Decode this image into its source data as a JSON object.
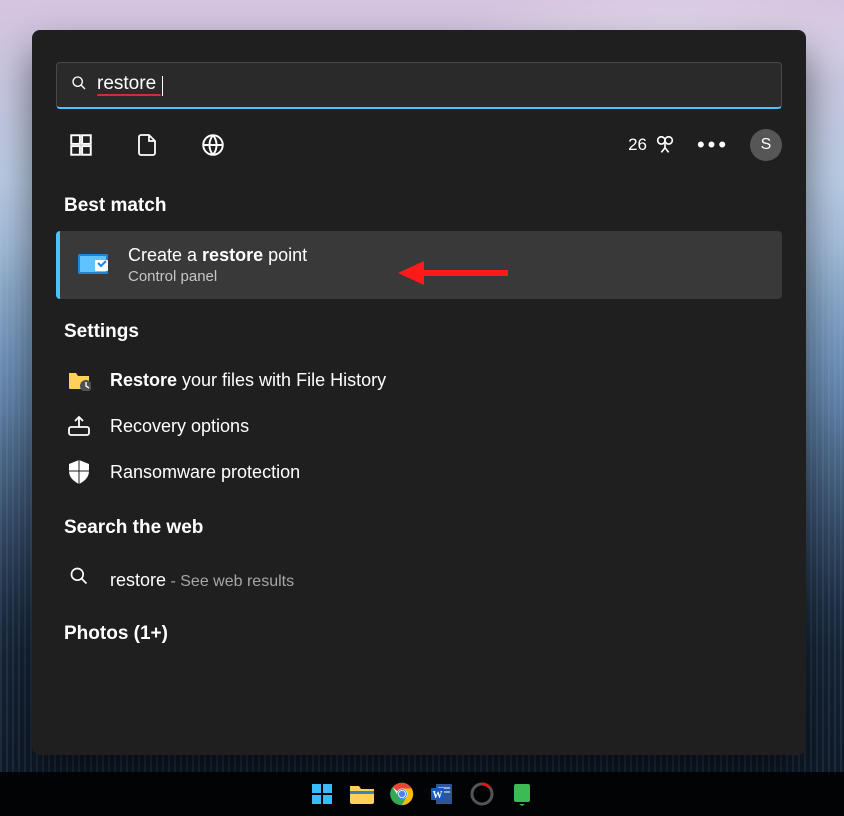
{
  "search": {
    "value": "restore"
  },
  "filters": {
    "points": "26",
    "avatar_initial": "S"
  },
  "sections": {
    "best_match_heading": "Best match",
    "settings_heading": "Settings",
    "web_heading": "Search the web",
    "photos_heading": "Photos (1+)"
  },
  "best_match": {
    "title_pre": "Create a ",
    "title_bold": "restore",
    "title_post": " point",
    "subtitle": "Control panel"
  },
  "settings_items": [
    {
      "bold": "Restore",
      "rest": " your files with File History",
      "icon": "folder-history-icon"
    },
    {
      "bold": "",
      "rest": "Recovery options",
      "icon": "recovery-icon"
    },
    {
      "bold": "",
      "rest": "Ransomware protection",
      "icon": "shield-icon"
    }
  ],
  "web": {
    "term": "restore",
    "suffix": " - See web results"
  }
}
